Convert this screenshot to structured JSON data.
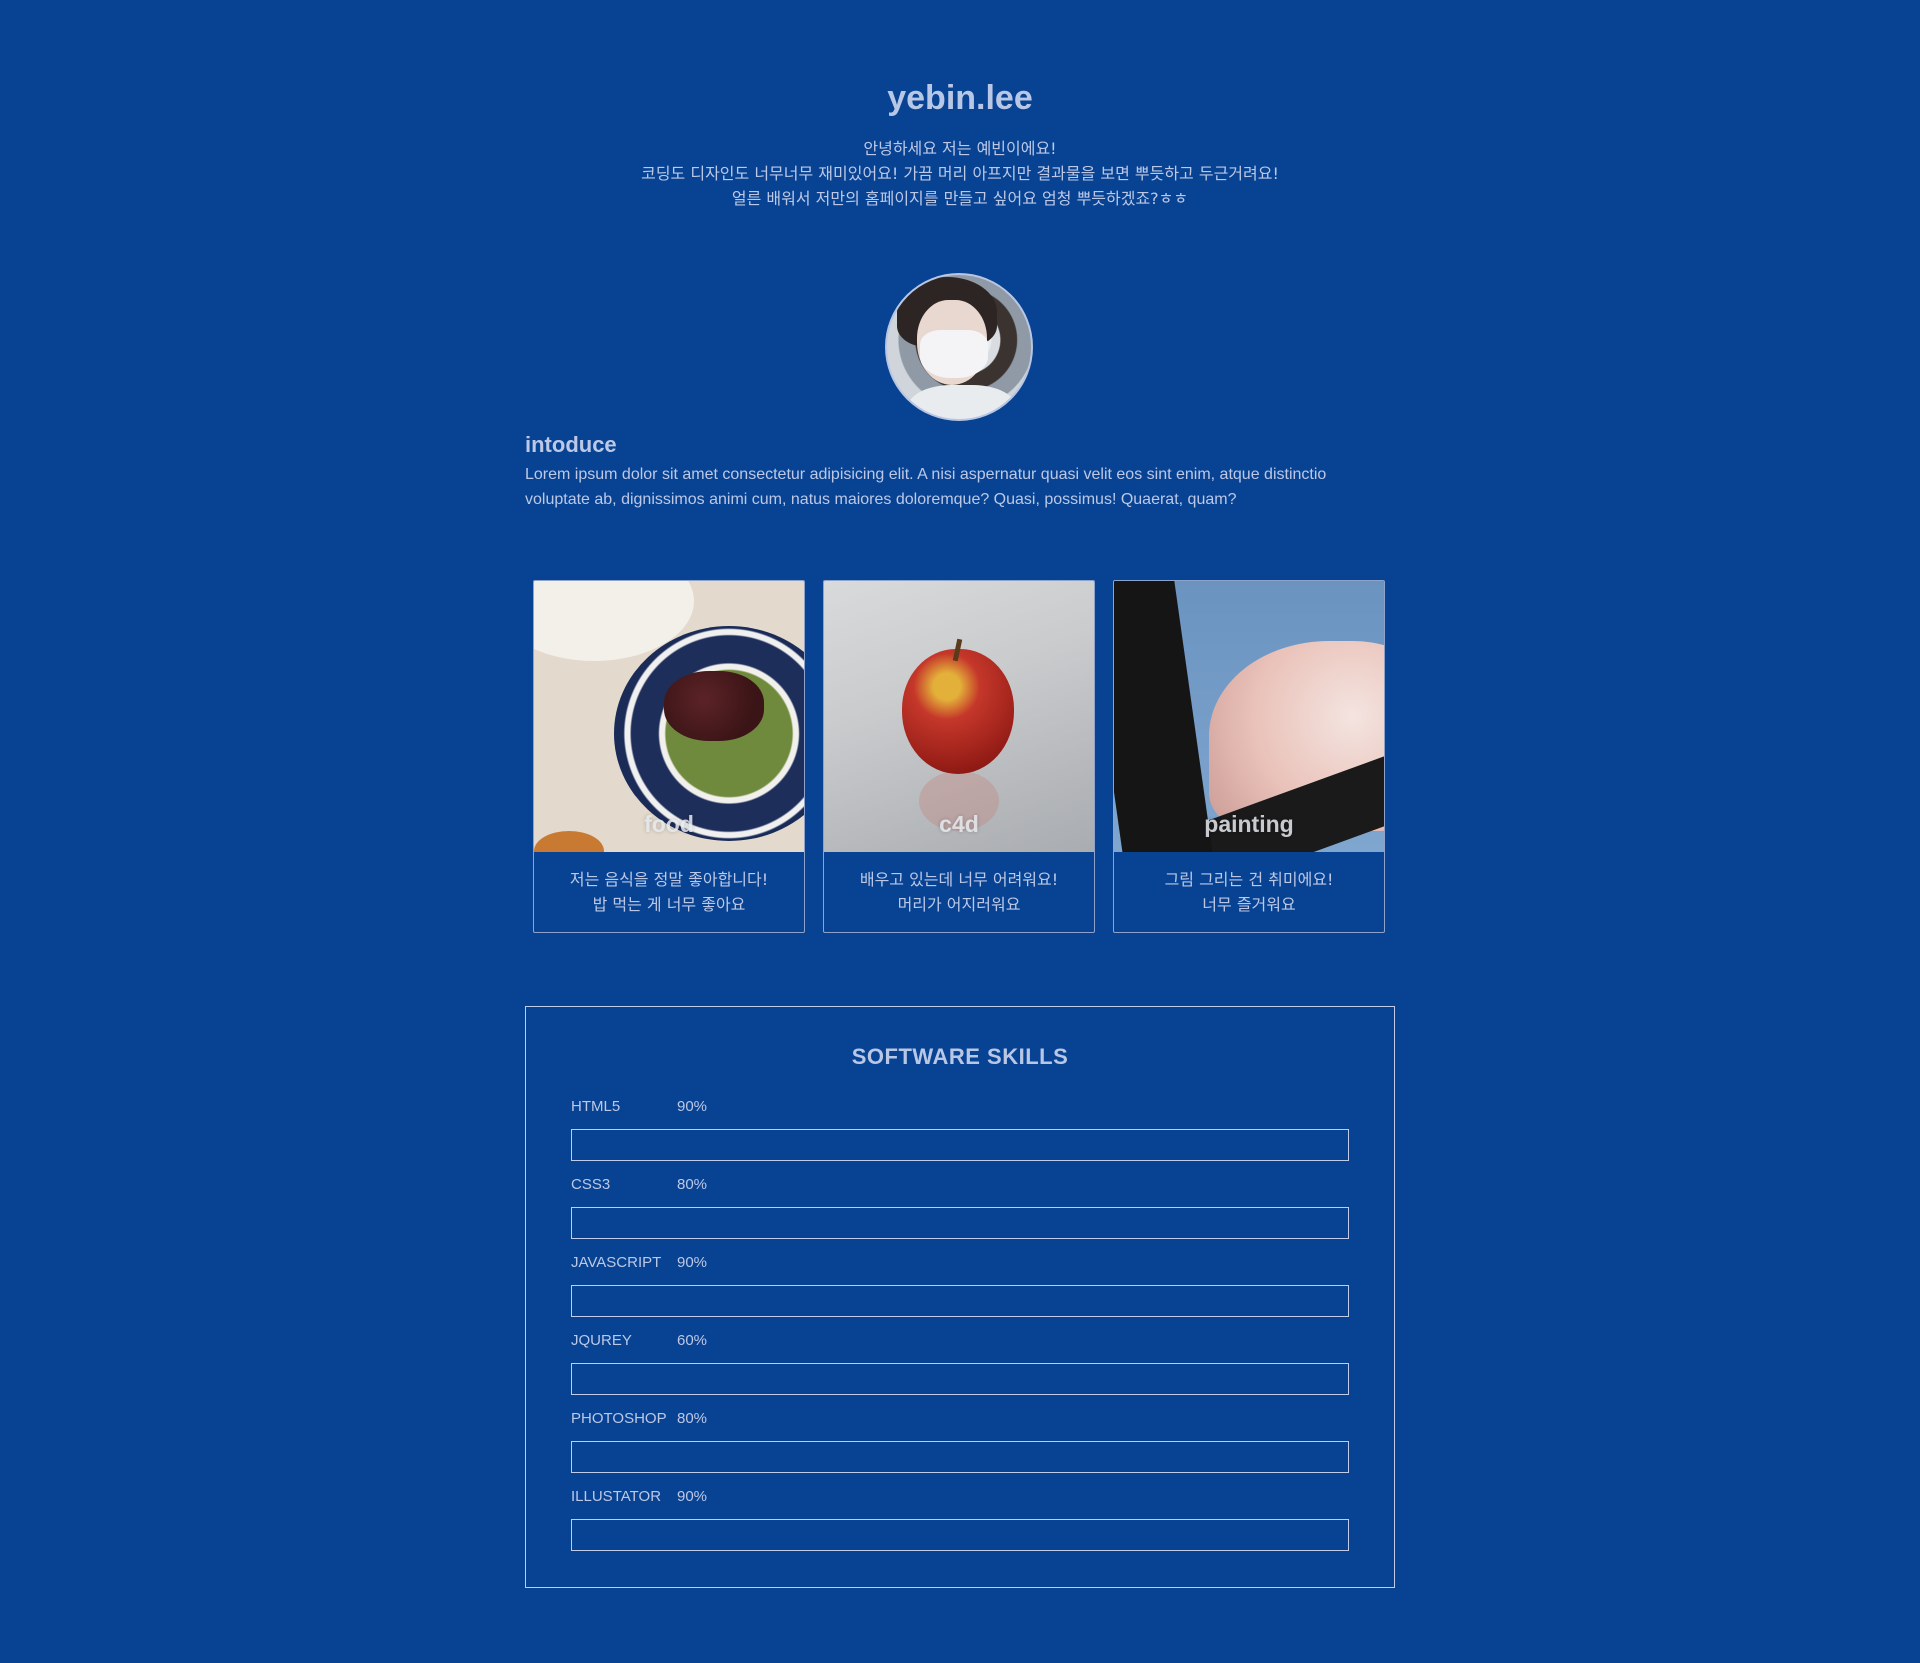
{
  "header": {
    "title": "yebin.lee",
    "greeting_lines": [
      "안녕하세요 저는 예빈이에요!",
      "코딩도 디자인도 너무너무 재미있어요! 가끔 머리 아프지만 결과물을 보면 뿌듯하고 두근거려요!",
      "얼른 배워서 저만의 홈페이지를 만들고 싶어요 엄청 뿌듯하겠죠?ㅎㅎ"
    ]
  },
  "avatar": {
    "icon": "profile-photo"
  },
  "intro": {
    "title": "intoduce",
    "text": "Lorem ipsum dolor sit amet consectetur adipisicing elit. A nisi aspernatur quasi velit eos sint enim, atque distinctio voluptate ab, dignissimos animi cum, natus maiores doloremque? Quasi, possimus! Quaerat, quam?"
  },
  "cards": [
    {
      "label": "food",
      "desc_lines": [
        "저는 음식을 정말 좋아합니다!",
        "밥 먹는 게 너무 좋아요"
      ]
    },
    {
      "label": "c4d",
      "desc_lines": [
        "배우고 있는데 너무 어려워요!",
        "머리가 어지러워요"
      ]
    },
    {
      "label": "painting",
      "desc_lines": [
        "그림 그리는 건 취미에요!",
        "너무 즐거워요"
      ]
    }
  ],
  "skills": {
    "title": "SOFTWARE SKILLS",
    "items": [
      {
        "name": "HTML5",
        "percent_label": "90%",
        "value": 90
      },
      {
        "name": "CSS3",
        "percent_label": "80%",
        "value": 80
      },
      {
        "name": "JAVASCRIPT",
        "percent_label": "90%",
        "value": 90
      },
      {
        "name": "JQUREY",
        "percent_label": "60%",
        "value": 60
      },
      {
        "name": "PHOTOSHOP",
        "percent_label": "80%",
        "value": 80
      },
      {
        "name": "ILLUSTATOR",
        "percent_label": "90%",
        "value": 90
      }
    ]
  },
  "colors": {
    "background": "#084393",
    "text": "#bcc8e6",
    "border": "#c0cce8"
  }
}
